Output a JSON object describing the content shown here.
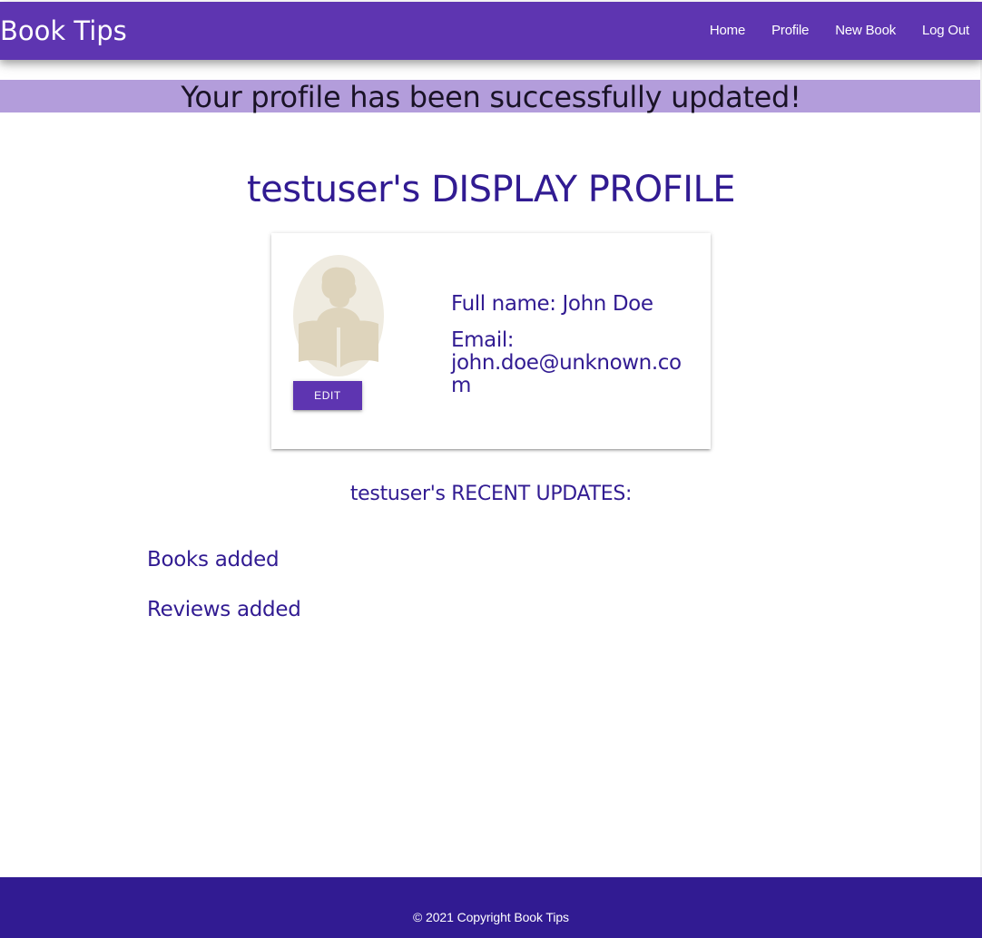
{
  "app": {
    "brand": "Book Tips"
  },
  "nav": {
    "items": [
      {
        "label": "Home"
      },
      {
        "label": "Profile"
      },
      {
        "label": "New Book"
      },
      {
        "label": "Log Out"
      }
    ]
  },
  "flash": {
    "message": "Your profile has been successfully updated!"
  },
  "profile": {
    "title": "testuser's DISPLAY PROFILE",
    "avatar_icon": "reader-avatar-icon",
    "edit_label": "EDIT",
    "full_name": "Full name: John Doe",
    "email_label": "Email:",
    "email_value": "john.doe@unknown.com"
  },
  "updates": {
    "title": "testuser's RECENT UPDATES:",
    "books_label": "Books added",
    "reviews_label": "Reviews added"
  },
  "footer": {
    "copyright": "© 2021 Copyright Book Tips"
  },
  "colors": {
    "nav_bg": "#5e35b1",
    "flash_bg": "#b39ddb",
    "text_primary": "#311b92",
    "footer_bg": "#311b92",
    "avatar_bg": "#efebe0",
    "avatar_fg": "#ded4bc"
  }
}
